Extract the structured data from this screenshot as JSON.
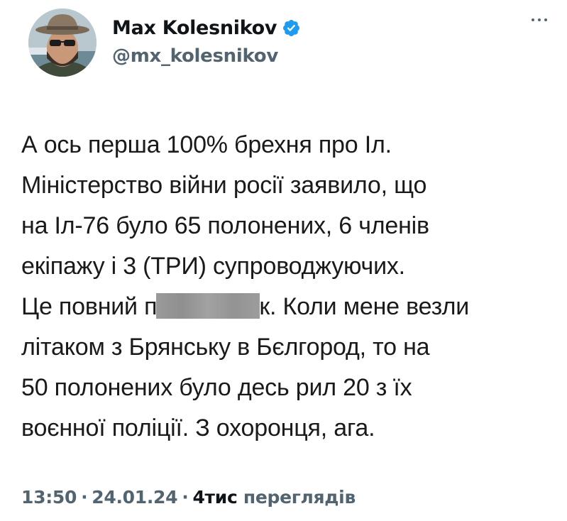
{
  "author": {
    "display_name": "Max Kolesnikov",
    "handle": "@mx_kolesnikov",
    "verified": true,
    "verified_badge_color": "#1d9bf0"
  },
  "menu": {
    "icon": "more-horizontal-icon"
  },
  "tweet": {
    "lines": [
      "А ось перша 100% брехня про Іл.",
      "Міністерство війни росії заявило, що",
      "на Іл-76 було 65 полонених, 6 членів",
      "екіпажу і 3 (ТРИ) супроводжуючих."
    ],
    "line5_before": "Це повний п",
    "line5_after": "к. Коли мене везли",
    "lines_rest": [
      "літаком з Брянську в Бєлгород, то на",
      "50 полонених було десь рил 20 з їх",
      "воєнної поліції. З охоронця, ага."
    ]
  },
  "meta": {
    "time": "13:50",
    "date": "24.01.24",
    "views_count": "4тис",
    "views_label": "переглядів",
    "separator": "·"
  },
  "colors": {
    "text": "#0f1419",
    "secondary": "#536471",
    "accent": "#1d9bf0"
  }
}
